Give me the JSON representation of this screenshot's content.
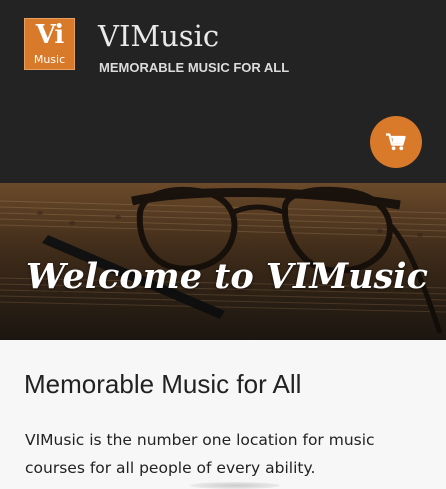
{
  "header": {
    "logo": {
      "line1": "Vi",
      "line2": "Music"
    },
    "title": "VIMusic",
    "tagline": "MEMORABLE MUSIC FOR ALL",
    "cart_icon": "shopping-cart-icon"
  },
  "hero": {
    "title": "Welcome to VIMusic",
    "image": "eyeglasses-on-sheet-music"
  },
  "main": {
    "heading": "Memorable Music for All",
    "body": "VIMusic is the number one location for music courses for all people of every ability."
  },
  "colors": {
    "accent": "#d9792a",
    "header_bg": "#232323",
    "content_bg": "#f7f7f7"
  }
}
